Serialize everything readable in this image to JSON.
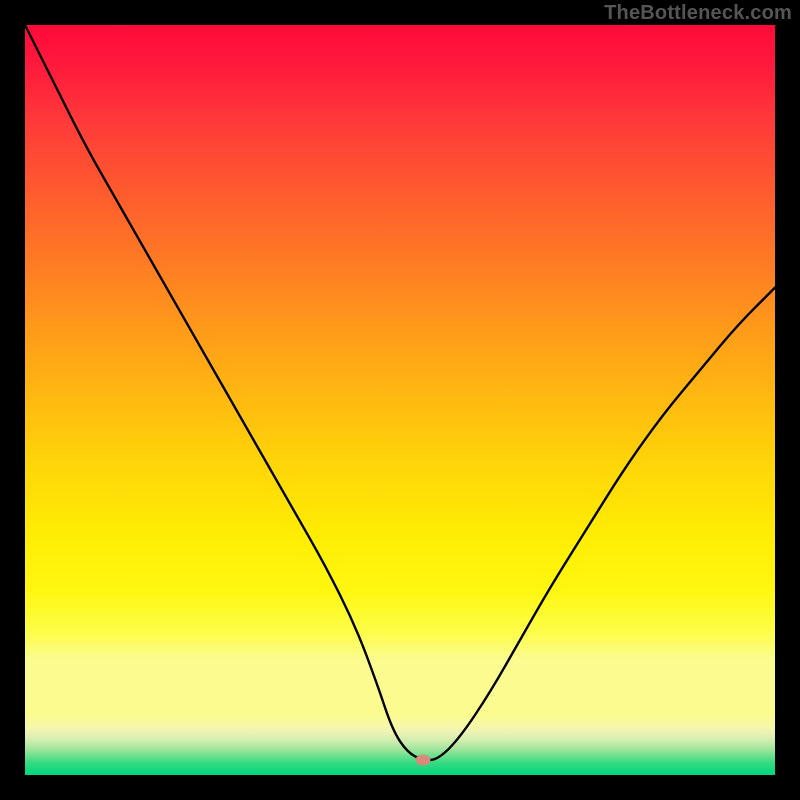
{
  "watermark": "TheBottleneck.com",
  "colors": {
    "frame": "#000000",
    "curve": "#000000",
    "marker": "#d98a7a",
    "gradient_top": "#ff0a3a",
    "gradient_bottom": "#00d77c"
  },
  "chart_data": {
    "type": "line",
    "title": "",
    "xlabel": "",
    "ylabel": "",
    "xlim": [
      0,
      100
    ],
    "ylim": [
      0,
      100
    ],
    "grid": false,
    "legend": false,
    "series": [
      {
        "name": "bottleneck-curve",
        "x": [
          0,
          4,
          8,
          12,
          16,
          20,
          24,
          28,
          32,
          36,
          40,
          44,
          47,
          49,
          51,
          53,
          55,
          58,
          62,
          66,
          70,
          75,
          80,
          85,
          90,
          95,
          100
        ],
        "y": [
          100,
          92,
          84,
          77,
          70,
          63,
          56,
          49,
          42,
          35,
          28,
          20,
          12,
          6,
          3,
          2,
          2,
          5,
          11,
          18,
          25,
          33,
          41,
          48,
          54,
          60,
          65
        ]
      }
    ],
    "marker": {
      "x": 53,
      "y": 2
    },
    "background_gradient": {
      "direction": "vertical",
      "stops": [
        {
          "pos": 0.0,
          "color": "#ff0a3a"
        },
        {
          "pos": 0.5,
          "color": "#ffb910"
        },
        {
          "pos": 0.82,
          "color": "#fff710"
        },
        {
          "pos": 0.92,
          "color": "#fbfb90"
        },
        {
          "pos": 1.0,
          "color": "#00d77c"
        }
      ]
    }
  }
}
